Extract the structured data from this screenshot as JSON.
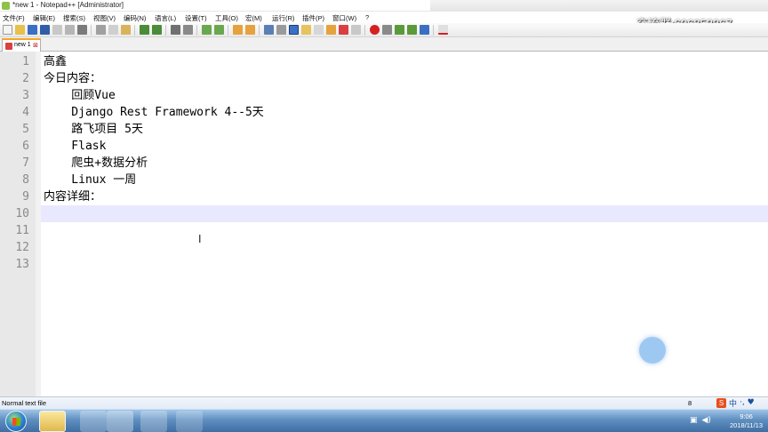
{
  "window": {
    "title": "*new 1 - Notepad++ [Administrator]"
  },
  "menu": {
    "items": [
      "文件(F)",
      "编辑(E)",
      "搜索(S)",
      "视图(V)",
      "编码(N)",
      "语言(L)",
      "设置(T)",
      "工具(O)",
      "宏(M)",
      "运行(R)",
      "插件(P)",
      "窗口(W)",
      "?"
    ]
  },
  "watermark": "交流群:606853367",
  "tabs": [
    {
      "label": "new 1",
      "close": "⊠"
    }
  ],
  "editor": {
    "line_numbers": [
      "1",
      "2",
      "3",
      "4",
      "5",
      "6",
      "7",
      "8",
      "9",
      "10",
      "11",
      "12",
      "13"
    ],
    "lines": [
      "高鑫",
      "今日内容：",
      "    回顾Vue",
      "    Django Rest Framework 4--5天",
      "    路飞项目 5天",
      "    Flask",
      "    爬虫+数据分析",
      "    Linux 一周",
      "内容详细：",
      "",
      "",
      "",
      ""
    ],
    "current_line": 10
  },
  "status": {
    "text": "Normal text file",
    "tail": "8"
  },
  "ime": {
    "logo": "S",
    "lang": "中",
    "extra": "·, ♥"
  },
  "clock": {
    "time": "9:06",
    "date": "2018/11/13"
  },
  "colors": {
    "gutter": "#e8e8e8",
    "current_line": "#e8e8ff",
    "tab_accent": "#f5a623"
  }
}
